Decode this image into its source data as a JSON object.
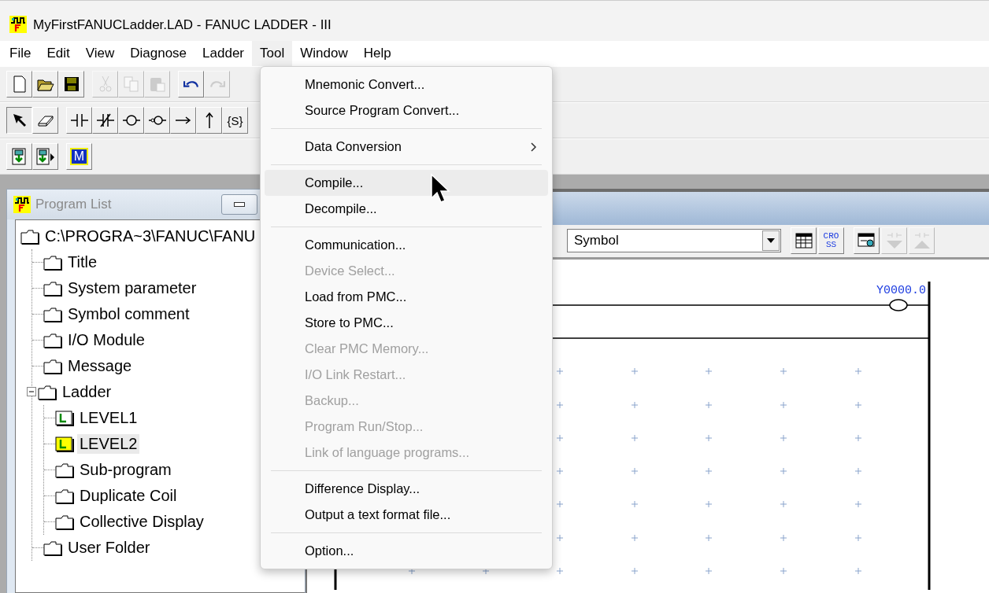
{
  "window": {
    "title": "MyFirstFANUCLadder.LAD - FANUC LADDER - III"
  },
  "menu_bar": [
    {
      "label": "File",
      "selected": false
    },
    {
      "label": "Edit",
      "selected": false
    },
    {
      "label": "View",
      "selected": false
    },
    {
      "label": "Diagnose",
      "selected": false
    },
    {
      "label": "Ladder",
      "selected": false
    },
    {
      "label": "Tool",
      "selected": true
    },
    {
      "label": "Window",
      "selected": false
    },
    {
      "label": "Help",
      "selected": false
    }
  ],
  "toolbar_file": [
    [
      {
        "kind": "new",
        "disabled": false
      },
      {
        "kind": "open",
        "disabled": false
      },
      {
        "kind": "save",
        "disabled": false
      }
    ],
    [
      {
        "kind": "cut",
        "disabled": true
      },
      {
        "kind": "copy",
        "disabled": true
      },
      {
        "kind": "paste",
        "disabled": true
      }
    ],
    [
      {
        "kind": "undo",
        "disabled": false
      },
      {
        "kind": "redo",
        "disabled": true
      }
    ]
  ],
  "toolbar_ladder": [
    [
      {
        "kind": "pointer",
        "selected": true
      },
      {
        "kind": "eraser",
        "selected": false
      }
    ],
    [
      {
        "kind": "contact",
        "selected": false
      },
      {
        "kind": "contact_nc",
        "selected": false
      },
      {
        "kind": "coil",
        "selected": false
      },
      {
        "kind": "coil_neg",
        "selected": false
      },
      {
        "kind": "hline",
        "selected": false
      },
      {
        "kind": "vline",
        "selected": false
      },
      {
        "kind": "text",
        "label": "{S}",
        "selected": false
      }
    ]
  ],
  "toolbar_transfer": [
    [
      {
        "kind": "download"
      },
      {
        "kind": "download_run"
      }
    ],
    [
      {
        "kind": "monitor",
        "label": "M"
      }
    ]
  ],
  "program_list": {
    "title": "Program List",
    "tree": {
      "label": "C:\\PROGRA~3\\FANUC\\FANU",
      "kind": "folder",
      "expanded": true,
      "selected": false,
      "children": [
        {
          "label": "Title",
          "kind": "folder",
          "selected": false
        },
        {
          "label": "System parameter",
          "kind": "folder",
          "selected": false
        },
        {
          "label": "Symbol comment",
          "kind": "folder",
          "selected": false
        },
        {
          "label": "I/O Module",
          "kind": "folder",
          "selected": false
        },
        {
          "label": "Message",
          "kind": "folder",
          "selected": false
        },
        {
          "label": "Ladder",
          "kind": "folder",
          "expanded": true,
          "selected": false,
          "children": [
            {
              "label": "LEVEL1",
              "kind": "level",
              "selected": false
            },
            {
              "label": "LEVEL2",
              "kind": "level",
              "selected": true
            },
            {
              "label": "Sub-program",
              "kind": "folder",
              "selected": false
            },
            {
              "label": "Duplicate Coil",
              "kind": "folder",
              "selected": false
            },
            {
              "label": "Collective Display",
              "kind": "folder",
              "selected": false
            }
          ]
        },
        {
          "label": "User Folder",
          "kind": "folder",
          "selected": false
        }
      ]
    }
  },
  "ladder_window": {
    "display_mode": "Symbol",
    "tools": [
      {
        "kind": "table",
        "disabled": false
      },
      {
        "kind": "text",
        "label_top": "CRO",
        "label_bottom": "SS",
        "disabled": false
      },
      {
        "kind": "screen",
        "disabled": false
      },
      {
        "kind": "down",
        "disabled": true
      },
      {
        "kind": "up",
        "disabled": true
      }
    ],
    "coil_address": "Y0000.0"
  },
  "tool_menu": [
    {
      "kind": "item",
      "label": "Mnemonic Convert...",
      "disabled": false,
      "selected": false
    },
    {
      "kind": "item",
      "label": "Source Program Convert...",
      "disabled": false,
      "selected": false
    },
    {
      "kind": "separator"
    },
    {
      "kind": "submenu",
      "label": "Data Conversion",
      "disabled": false,
      "selected": false
    },
    {
      "kind": "separator"
    },
    {
      "kind": "item",
      "label": "Compile...",
      "disabled": false,
      "selected": true
    },
    {
      "kind": "item",
      "label": "Decompile...",
      "disabled": false,
      "selected": false
    },
    {
      "kind": "separator"
    },
    {
      "kind": "item",
      "label": "Communication...",
      "disabled": false,
      "selected": false
    },
    {
      "kind": "item",
      "label": "Device Select...",
      "disabled": true,
      "selected": false
    },
    {
      "kind": "item",
      "label": "Load from PMC...",
      "disabled": false,
      "selected": false
    },
    {
      "kind": "item",
      "label": "Store to PMC...",
      "disabled": false,
      "selected": false
    },
    {
      "kind": "item",
      "label": "Clear PMC Memory...",
      "disabled": true,
      "selected": false
    },
    {
      "kind": "item",
      "label": "I/O Link Restart...",
      "disabled": true,
      "selected": false
    },
    {
      "kind": "item",
      "label": "Backup...",
      "disabled": true,
      "selected": false
    },
    {
      "kind": "item",
      "label": "Program Run/Stop...",
      "disabled": true,
      "selected": false
    },
    {
      "kind": "item",
      "label": "Link of language programs...",
      "disabled": true,
      "selected": false
    },
    {
      "kind": "separator"
    },
    {
      "kind": "item",
      "label": "Difference Display...",
      "disabled": false,
      "selected": false
    },
    {
      "kind": "item",
      "label": "Output a text format file...",
      "disabled": false,
      "selected": false
    },
    {
      "kind": "separator"
    },
    {
      "kind": "item",
      "label": "Option...",
      "disabled": false,
      "selected": false
    }
  ]
}
